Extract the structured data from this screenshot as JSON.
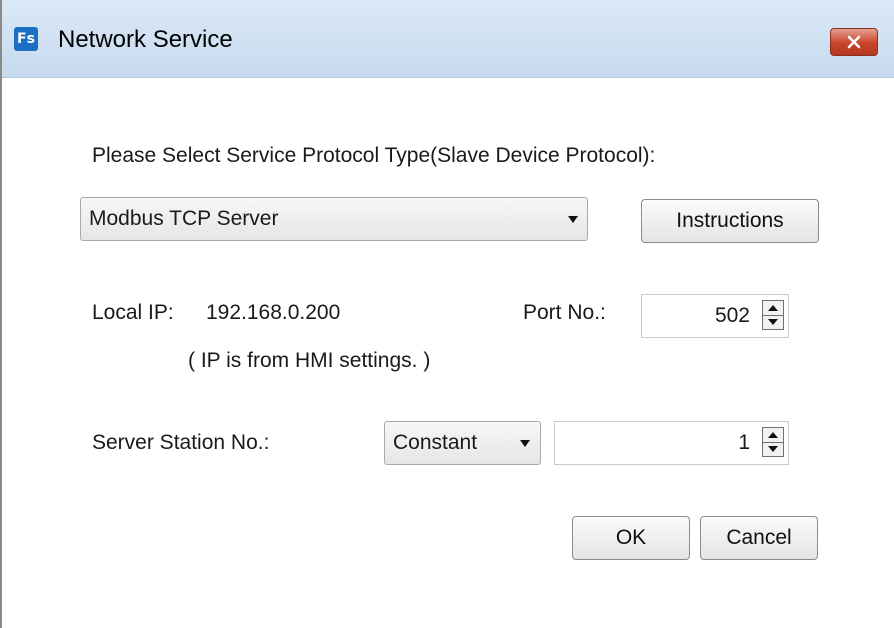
{
  "window": {
    "title": "Network Service",
    "app_icon_text": "Fs"
  },
  "protocol": {
    "prompt": "Please Select Service Protocol Type(Slave Device Protocol):",
    "selected": "Modbus TCP Server",
    "instructions_label": "Instructions"
  },
  "network": {
    "local_ip_label": "Local IP:",
    "local_ip_value": "192.168.0.200",
    "ip_note": "( IP is from HMI settings. )",
    "port_label": "Port No.:",
    "port_value": "502"
  },
  "station": {
    "label": "Server Station No.:",
    "mode_selected": "Constant",
    "value": "1"
  },
  "actions": {
    "ok_label": "OK",
    "cancel_label": "Cancel"
  },
  "colors": {
    "titlebar": "#cfe0f2",
    "close_button": "#c7432a",
    "app_icon": "#1d6fc4"
  },
  "icons": {
    "app": "fs-app-icon",
    "close": "close-icon",
    "dropdown": "chevron-down-icon",
    "spinner_up": "arrow-up-icon",
    "spinner_down": "arrow-down-icon"
  }
}
